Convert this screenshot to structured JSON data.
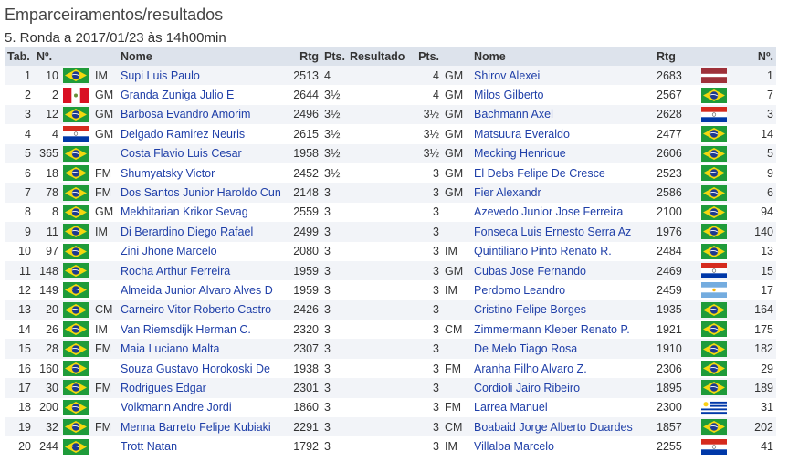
{
  "header": {
    "title": "Emparceiramentos/resultados",
    "round": "5. Ronda a 2017/01/23 às 14h00min"
  },
  "columns": {
    "tab": "Tab.",
    "no": "Nº.",
    "name": "Nome",
    "rtg": "Rtg",
    "pts": "Pts.",
    "result": "Resultado",
    "pts2": "Pts.",
    "name2": "Nome",
    "rtg2": "Rtg",
    "no2": "Nº."
  },
  "rows": [
    {
      "tab": "1",
      "no": "10",
      "flag": "bra",
      "title": "IM",
      "name": "Supi Luis Paulo",
      "rtg": "2513",
      "pts": "4",
      "result": "",
      "pts2": "4",
      "title2": "GM",
      "name2": "Shirov Alexei",
      "rtg2": "2683",
      "flag2": "lat",
      "no2": "1"
    },
    {
      "tab": "2",
      "no": "2",
      "flag": "per",
      "title": "GM",
      "name": "Granda Zuniga Julio E",
      "rtg": "2644",
      "pts": "3½",
      "result": "",
      "pts2": "4",
      "title2": "GM",
      "name2": "Milos Gilberto",
      "rtg2": "2567",
      "flag2": "bra",
      "no2": "7"
    },
    {
      "tab": "3",
      "no": "12",
      "flag": "bra",
      "title": "GM",
      "name": "Barbosa Evandro Amorim",
      "rtg": "2496",
      "pts": "3½",
      "result": "",
      "pts2": "3½",
      "title2": "GM",
      "name2": "Bachmann Axel",
      "rtg2": "2628",
      "flag2": "par",
      "no2": "3"
    },
    {
      "tab": "4",
      "no": "4",
      "flag": "par",
      "title": "GM",
      "name": "Delgado Ramirez Neuris",
      "rtg": "2615",
      "pts": "3½",
      "result": "",
      "pts2": "3½",
      "title2": "GM",
      "name2": "Matsuura Everaldo",
      "rtg2": "2477",
      "flag2": "bra",
      "no2": "14"
    },
    {
      "tab": "5",
      "no": "365",
      "flag": "bra",
      "title": "",
      "name": "Costa Flavio Luis Cesar",
      "rtg": "1958",
      "pts": "3½",
      "result": "",
      "pts2": "3½",
      "title2": "GM",
      "name2": "Mecking Henrique",
      "rtg2": "2606",
      "flag2": "bra",
      "no2": "5"
    },
    {
      "tab": "6",
      "no": "18",
      "flag": "bra",
      "title": "FM",
      "name": "Shumyatsky Victor",
      "rtg": "2452",
      "pts": "3½",
      "result": "",
      "pts2": "3",
      "title2": "GM",
      "name2": "El Debs Felipe De Cresce",
      "rtg2": "2523",
      "flag2": "bra",
      "no2": "9"
    },
    {
      "tab": "7",
      "no": "78",
      "flag": "bra",
      "title": "FM",
      "name": "Dos Santos Junior Haroldo Cun",
      "rtg": "2148",
      "pts": "3",
      "result": "",
      "pts2": "3",
      "title2": "GM",
      "name2": "Fier Alexandr",
      "rtg2": "2586",
      "flag2": "bra",
      "no2": "6"
    },
    {
      "tab": "8",
      "no": "8",
      "flag": "bra",
      "title": "GM",
      "name": "Mekhitarian Krikor Sevag",
      "rtg": "2559",
      "pts": "3",
      "result": "",
      "pts2": "3",
      "title2": "",
      "name2": "Azevedo Junior Jose Ferreira",
      "rtg2": "2100",
      "flag2": "bra",
      "no2": "94"
    },
    {
      "tab": "9",
      "no": "11",
      "flag": "bra",
      "title": "IM",
      "name": "Di Berardino Diego Rafael",
      "rtg": "2499",
      "pts": "3",
      "result": "",
      "pts2": "3",
      "title2": "",
      "name2": "Fonseca Luis Ernesto Serra Az",
      "rtg2": "1976",
      "flag2": "bra",
      "no2": "140"
    },
    {
      "tab": "10",
      "no": "97",
      "flag": "bra",
      "title": "",
      "name": "Zini Jhone Marcelo",
      "rtg": "2080",
      "pts": "3",
      "result": "",
      "pts2": "3",
      "title2": "IM",
      "name2": "Quintiliano Pinto Renato R.",
      "rtg2": "2484",
      "flag2": "bra",
      "no2": "13"
    },
    {
      "tab": "11",
      "no": "148",
      "flag": "bra",
      "title": "",
      "name": "Rocha Arthur Ferreira",
      "rtg": "1959",
      "pts": "3",
      "result": "",
      "pts2": "3",
      "title2": "GM",
      "name2": "Cubas Jose Fernando",
      "rtg2": "2469",
      "flag2": "par",
      "no2": "15"
    },
    {
      "tab": "12",
      "no": "149",
      "flag": "bra",
      "title": "",
      "name": "Almeida Junior Alvaro Alves D",
      "rtg": "1959",
      "pts": "3",
      "result": "",
      "pts2": "3",
      "title2": "IM",
      "name2": "Perdomo Leandro",
      "rtg2": "2459",
      "flag2": "arg",
      "no2": "17"
    },
    {
      "tab": "13",
      "no": "20",
      "flag": "bra",
      "title": "CM",
      "name": "Carneiro Vitor Roberto Castro",
      "rtg": "2426",
      "pts": "3",
      "result": "",
      "pts2": "3",
      "title2": "",
      "name2": "Cristino Felipe Borges",
      "rtg2": "1935",
      "flag2": "bra",
      "no2": "164"
    },
    {
      "tab": "14",
      "no": "26",
      "flag": "bra",
      "title": "IM",
      "name": "Van Riemsdijk Herman C.",
      "rtg": "2320",
      "pts": "3",
      "result": "",
      "pts2": "3",
      "title2": "CM",
      "name2": "Zimmermann Kleber Renato P.",
      "rtg2": "1921",
      "flag2": "bra",
      "no2": "175"
    },
    {
      "tab": "15",
      "no": "28",
      "flag": "bra",
      "title": "FM",
      "name": "Maia Luciano Malta",
      "rtg": "2307",
      "pts": "3",
      "result": "",
      "pts2": "3",
      "title2": "",
      "name2": "De Melo Tiago Rosa",
      "rtg2": "1910",
      "flag2": "bra",
      "no2": "182"
    },
    {
      "tab": "16",
      "no": "160",
      "flag": "bra",
      "title": "",
      "name": "Souza Gustavo Horokoski De",
      "rtg": "1938",
      "pts": "3",
      "result": "",
      "pts2": "3",
      "title2": "FM",
      "name2": "Aranha Filho Alvaro Z.",
      "rtg2": "2306",
      "flag2": "bra",
      "no2": "29"
    },
    {
      "tab": "17",
      "no": "30",
      "flag": "bra",
      "title": "FM",
      "name": "Rodrigues Edgar",
      "rtg": "2301",
      "pts": "3",
      "result": "",
      "pts2": "3",
      "title2": "",
      "name2": "Cordioli Jairo Ribeiro",
      "rtg2": "1895",
      "flag2": "bra",
      "no2": "189"
    },
    {
      "tab": "18",
      "no": "200",
      "flag": "bra",
      "title": "",
      "name": "Volkmann Andre Jordi",
      "rtg": "1860",
      "pts": "3",
      "result": "",
      "pts2": "3",
      "title2": "FM",
      "name2": "Larrea Manuel",
      "rtg2": "2300",
      "flag2": "uru",
      "no2": "31"
    },
    {
      "tab": "19",
      "no": "32",
      "flag": "bra",
      "title": "FM",
      "name": "Menna Barreto Felipe Kubiaki",
      "rtg": "2291",
      "pts": "3",
      "result": "",
      "pts2": "3",
      "title2": "CM",
      "name2": "Boabaid Jorge Alberto Duardes",
      "rtg2": "1857",
      "flag2": "bra",
      "no2": "202"
    },
    {
      "tab": "20",
      "no": "244",
      "flag": "bra",
      "title": "",
      "name": "Trott Natan",
      "rtg": "1792",
      "pts": "3",
      "result": "",
      "pts2": "3",
      "title2": "IM",
      "name2": "Villalba Marcelo",
      "rtg2": "2255",
      "flag2": "par",
      "no2": "41"
    }
  ],
  "flags": {
    "bra": "brazil-flag-icon",
    "per": "peru-flag-icon",
    "par": "paraguay-flag-icon",
    "lat": "latvia-flag-icon",
    "arg": "argentina-flag-icon",
    "uru": "uruguay-flag-icon"
  },
  "colors": {
    "header_bg": "#dde3ec",
    "link": "#1f3fa8",
    "row_alt": "#f2f4f8"
  }
}
